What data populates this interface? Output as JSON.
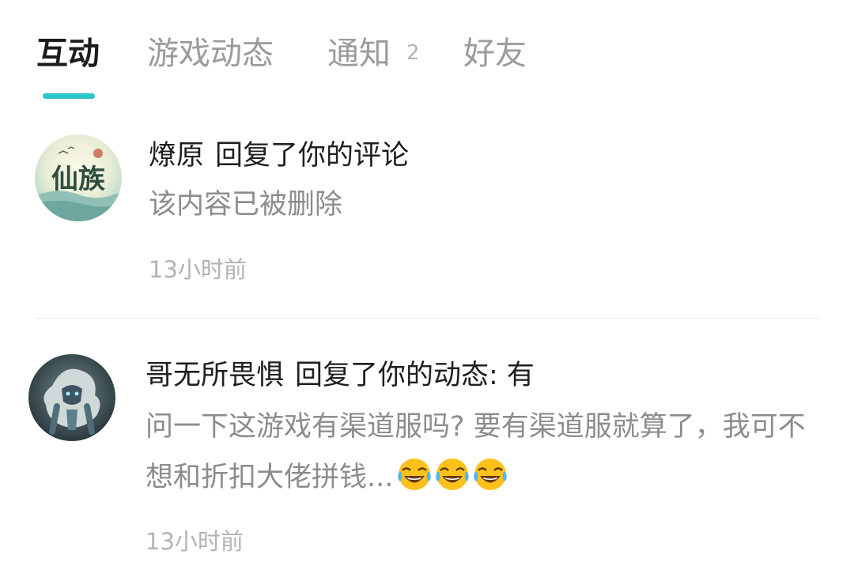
{
  "tabs": [
    {
      "label": "互动",
      "active": true
    },
    {
      "label": "游戏动态",
      "active": false
    },
    {
      "label": "通知",
      "active": false,
      "badge": "2"
    },
    {
      "label": "好友",
      "active": false
    }
  ],
  "accent_color": "#2ec4cc",
  "notifications": [
    {
      "user": "燎原",
      "action": "回复了你的评论",
      "content": "该内容已被删除",
      "time": "13小时前",
      "avatar_text": "仙族"
    },
    {
      "user": "哥无所畏惧",
      "action": "回复了你的动态: 有",
      "content": "问一下这游戏有渠道服吗? 要有渠道服就算了，我可不想和折扣大佬拼钱...",
      "emoji": [
        "face-with-tears-of-joy",
        "face-with-tears-of-joy",
        "face-with-tears-of-joy"
      ],
      "time": "13小时前"
    }
  ]
}
